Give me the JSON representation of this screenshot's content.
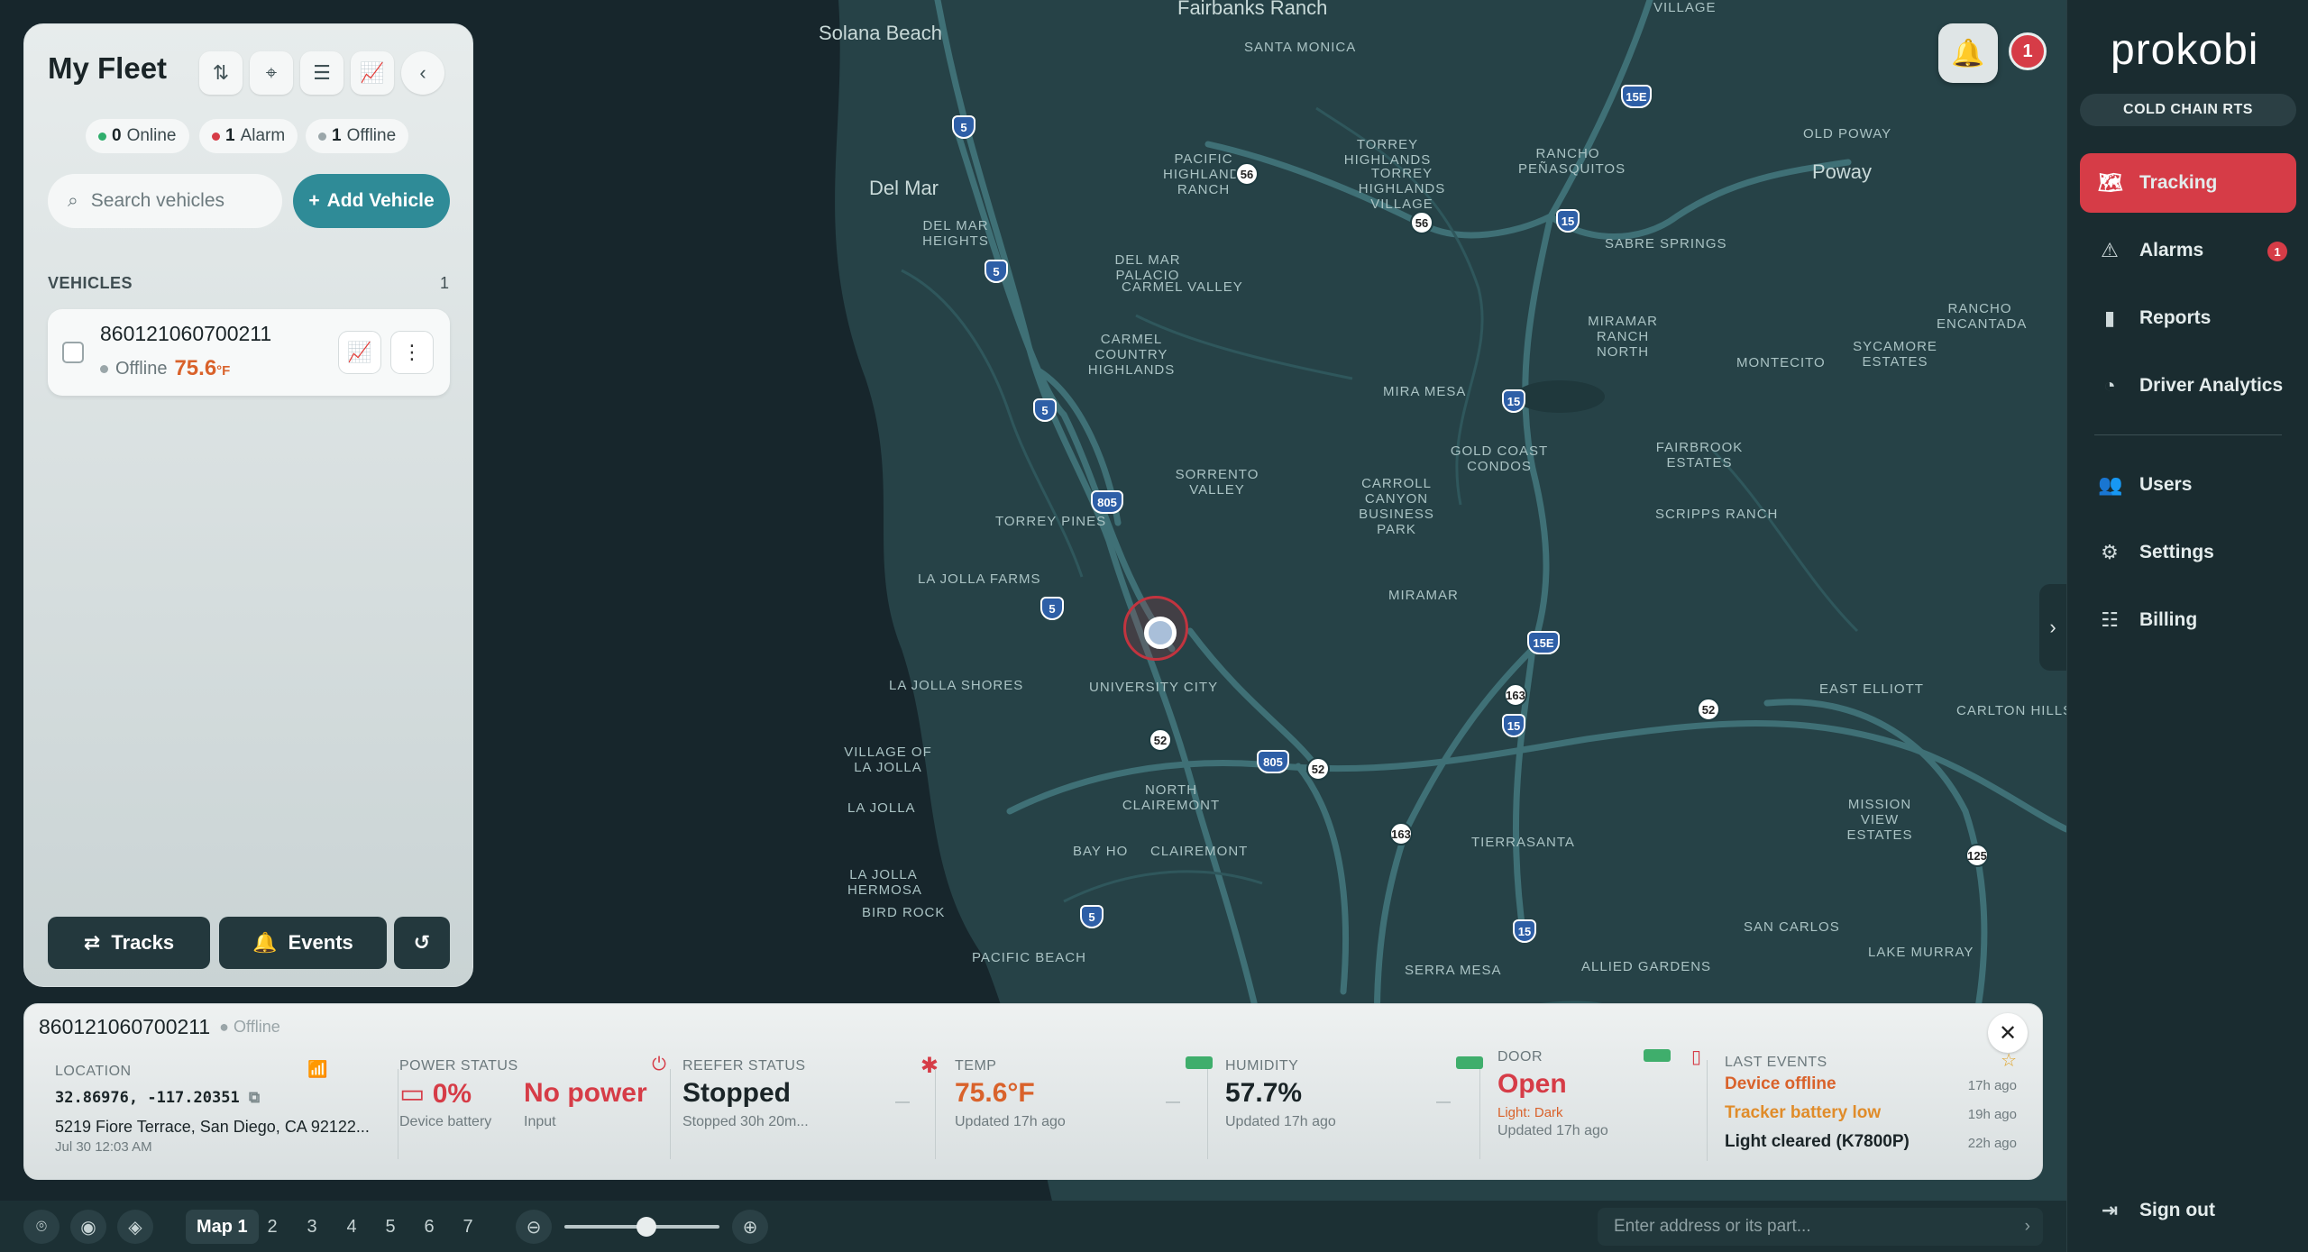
{
  "map": {
    "places": [
      {
        "t": "Solana Beach",
        "c": "big"
      },
      {
        "t": "Del Mar",
        "c": "big"
      },
      {
        "t": "Poway",
        "c": "big"
      },
      {
        "t": "Fairbanks Ranch",
        "c": "big"
      },
      {
        "t": "SANTA MONICA",
        "c": ""
      },
      {
        "t": "VILLAGE",
        "c": ""
      },
      {
        "t": "OLD POWAY",
        "c": ""
      },
      {
        "t": "PACIFIC HIGHLANDS RANCH",
        "c": ""
      },
      {
        "t": "TORREY HIGHLANDS",
        "c": ""
      },
      {
        "t": "TORREY HIGHLANDS VILLAGE",
        "c": ""
      },
      {
        "t": "RANCHO PEÑASQUITOS",
        "c": ""
      },
      {
        "t": "SABRE SPRINGS",
        "c": ""
      },
      {
        "t": "DEL MAR HEIGHTS",
        "c": ""
      },
      {
        "t": "DEL MAR PALACIO",
        "c": ""
      },
      {
        "t": "CARMEL VALLEY",
        "c": ""
      },
      {
        "t": "MIRAMAR RANCH NORTH",
        "c": ""
      },
      {
        "t": "RANCHO ENCANTADA",
        "c": ""
      },
      {
        "t": "SYCAMORE ESTATES",
        "c": ""
      },
      {
        "t": "MONTECITO",
        "c": ""
      },
      {
        "t": "CARMEL COUNTRY HIGHLANDS",
        "c": ""
      },
      {
        "t": "MIRA MESA",
        "c": ""
      },
      {
        "t": "GOLD COAST CONDOS",
        "c": ""
      },
      {
        "t": "FAIRBROOK ESTATES",
        "c": ""
      },
      {
        "t": "SORRENTO VALLEY",
        "c": ""
      },
      {
        "t": "CARROLL CANYON BUSINESS PARK",
        "c": ""
      },
      {
        "t": "SCRIPPS RANCH",
        "c": ""
      },
      {
        "t": "TORREY PINES",
        "c": ""
      },
      {
        "t": "LA JOLLA FARMS",
        "c": ""
      },
      {
        "t": "MIRAMAR",
        "c": ""
      },
      {
        "t": "LA JOLLA SHORES",
        "c": ""
      },
      {
        "t": "UNIVERSITY CITY",
        "c": ""
      },
      {
        "t": "EAST ELLIOTT",
        "c": ""
      },
      {
        "t": "CARLTON HILLS",
        "c": ""
      },
      {
        "t": "VILLAGE OF LA JOLLA",
        "c": ""
      },
      {
        "t": "LA JOLLA",
        "c": ""
      },
      {
        "t": "NORTH CLAIREMONT",
        "c": ""
      },
      {
        "t": "MISSION VIEW ESTATES",
        "c": ""
      },
      {
        "t": "BAY HO",
        "c": ""
      },
      {
        "t": "CLAIREMONT",
        "c": ""
      },
      {
        "t": "TIERRASANTA",
        "c": ""
      },
      {
        "t": "LA JOLLA HERMOSA",
        "c": ""
      },
      {
        "t": "BIRD ROCK",
        "c": ""
      },
      {
        "t": "SAN CARLOS",
        "c": ""
      },
      {
        "t": "LAKE MURRAY",
        "c": ""
      },
      {
        "t": "PACIFIC BEACH",
        "c": ""
      },
      {
        "t": "SERRA MESA",
        "c": ""
      },
      {
        "t": "ALLIED GARDENS",
        "c": ""
      }
    ],
    "shields": [
      "5",
      "56",
      "15E",
      "56",
      "15",
      "5",
      "5",
      "805",
      "15",
      "5",
      "15E",
      "163",
      "15",
      "52",
      "52",
      "805",
      "52",
      "163",
      "125",
      "5",
      "15"
    ]
  },
  "fleet": {
    "title": "My Fleet",
    "online_count": "0",
    "online_label": "Online",
    "alarm_count": "1",
    "alarm_label": "Alarm",
    "offline_count": "1",
    "offline_label": "Offline",
    "search_placeholder": "Search vehicles",
    "add_label": "Add Vehicle",
    "vehicles_label": "VEHICLES",
    "vehicles_count": "1",
    "vehicle": {
      "id": "860121060700211",
      "status": "Offline",
      "temp": "75.6",
      "unit": "°F"
    },
    "tracks_label": "Tracks",
    "events_label": "Events"
  },
  "nav": {
    "logo": "prokobi",
    "org": "COLD CHAIN RTS",
    "items": [
      {
        "label": "Tracking"
      },
      {
        "label": "Alarms",
        "badge": "1"
      },
      {
        "label": "Reports"
      },
      {
        "label": "Driver Analytics"
      },
      {
        "label": "Users"
      },
      {
        "label": "Settings"
      },
      {
        "label": "Billing"
      }
    ],
    "signout": "Sign out"
  },
  "notifications": {
    "count": "1"
  },
  "detail": {
    "id": "860121060700211",
    "status": "Offline",
    "location": {
      "label": "LOCATION",
      "coords": "32.86976, -117.20351",
      "address": "5219 Fiore Terrace, San Diego, CA 92122...",
      "time": "Jul 30 12:03 AM"
    },
    "power": {
      "label": "POWER STATUS",
      "battery": "0%",
      "battery_sub": "Device battery",
      "input": "No power",
      "input_sub": "Input"
    },
    "reefer": {
      "label": "REEFER STATUS",
      "value": "Stopped",
      "sub": "Stopped 30h 20m...",
      "dash": "—"
    },
    "temp": {
      "label": "TEMP",
      "value": "75.6°F",
      "sub": "Updated 17h ago",
      "dash": "—"
    },
    "humidity": {
      "label": "HUMIDITY",
      "value": "57.7%",
      "sub": "Updated 17h ago",
      "dash": "—"
    },
    "door": {
      "label": "DOOR",
      "value": "Open",
      "light": "Light: Dark",
      "sub": "Updated 17h ago"
    },
    "events": {
      "label": "LAST EVENTS",
      "items": [
        {
          "text": "Device offline",
          "time": "17h ago"
        },
        {
          "text": "Tracker battery low",
          "time": "19h ago"
        },
        {
          "text": "Light cleared (K7800P)",
          "time": "22h ago"
        }
      ]
    }
  },
  "bottom": {
    "maps": [
      "Map 1",
      "2",
      "3",
      "4",
      "5",
      "6",
      "7"
    ],
    "address_placeholder": "Enter address or its part..."
  },
  "colors": {
    "accent": "#d63c47",
    "teal": "#2f8b97",
    "orange": "#d9622b",
    "map_bg": "#264247"
  }
}
